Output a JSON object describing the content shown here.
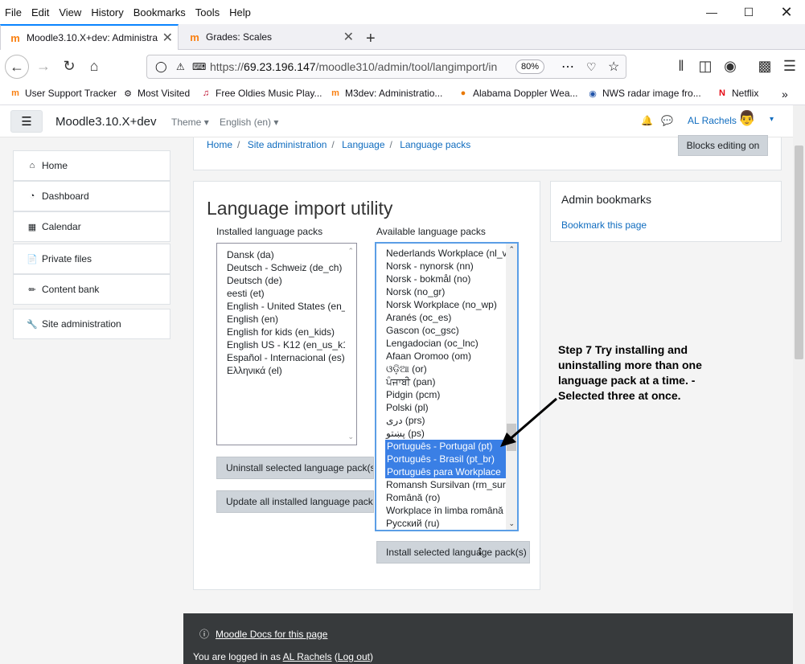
{
  "menu": [
    "File",
    "Edit",
    "View",
    "History",
    "Bookmarks",
    "Tools",
    "Help"
  ],
  "tabs": [
    {
      "label": "Moodle3.10.X+dev: Administra",
      "active": true
    },
    {
      "label": "Grades: Scales",
      "active": false
    }
  ],
  "address": {
    "prefix": "https://",
    "host": "69.23.196.147",
    "path": "/moodle310/admin/tool/langimport/in",
    "zoom": "80%"
  },
  "bookmarks": [
    "User Support Tracker",
    "Most Visited",
    "Free Oldies Music Play...",
    "M3dev: Administratio...",
    "Alabama Doppler Wea...",
    "NWS radar image fro...",
    "Netflix"
  ],
  "moodle_nav": {
    "site_name": "Moodle3.10.X+dev",
    "theme": "Theme",
    "language": "English (en)",
    "user": "AL Rachels"
  },
  "sidebar": [
    "Home",
    "Dashboard",
    "Calendar",
    "Private files",
    "Content bank",
    "Site administration"
  ],
  "breadcrumb": [
    "Home",
    "Site administration",
    "Language",
    "Language packs"
  ],
  "blocks_button": "Blocks editing on",
  "page_title": "Language import utility",
  "installed": {
    "label": "Installed language packs",
    "items": [
      "Dansk (da)",
      "Deutsch - Schweiz (de_ch)",
      "Deutsch (de)",
      "eesti (et)",
      "English - United States (en_",
      "English (en)",
      "English for kids (en_kids)",
      "English US - K12 (en_us_k12",
      "Español - Internacional (es)",
      "Ελληνικά (el)"
    ]
  },
  "available": {
    "label": "Available language packs",
    "items": [
      "Nederlands Workplace (nl_v",
      "Norsk - nynorsk (nn)",
      "Norsk - bokmål (no)",
      "Norsk (no_gr)",
      "Norsk Workplace (no_wp)",
      "Aranés (oc_es)",
      "Gascon (oc_gsc)",
      "Lengadocian (oc_lnc)",
      "Afaan Oromoo (om)",
      "ଓଡ଼ିଆ (or)",
      "ਪੰਜਾਬੀ (pan)",
      "Pidgin (pcm)",
      "Polski (pl)",
      "دری (prs)",
      "پښتو (ps)",
      "Português - Portugal (pt)",
      "Português - Brasil (pt_br)",
      "Português para Workplace",
      "Romansh Sursilvan (rm_sur",
      "Română (ro)",
      "Workplace în limba română",
      "Русский (ru)"
    ],
    "selected": [
      15,
      16,
      17
    ]
  },
  "buttons": {
    "uninstall": "Uninstall selected language pack(s)",
    "update": "Update all installed language packs",
    "install": "Install selected language pack(s)"
  },
  "admin_bookmarks": {
    "title": "Admin bookmarks",
    "link": "Bookmark this page"
  },
  "annotation": "Step 7 Try installing and uninstalling more than one language pack at a time. - Selected three at once.",
  "footer": {
    "docs": "Moodle Docs for this page",
    "logged_prefix": "You are logged in as ",
    "user": "AL Rachels",
    "logout": "Log out"
  }
}
